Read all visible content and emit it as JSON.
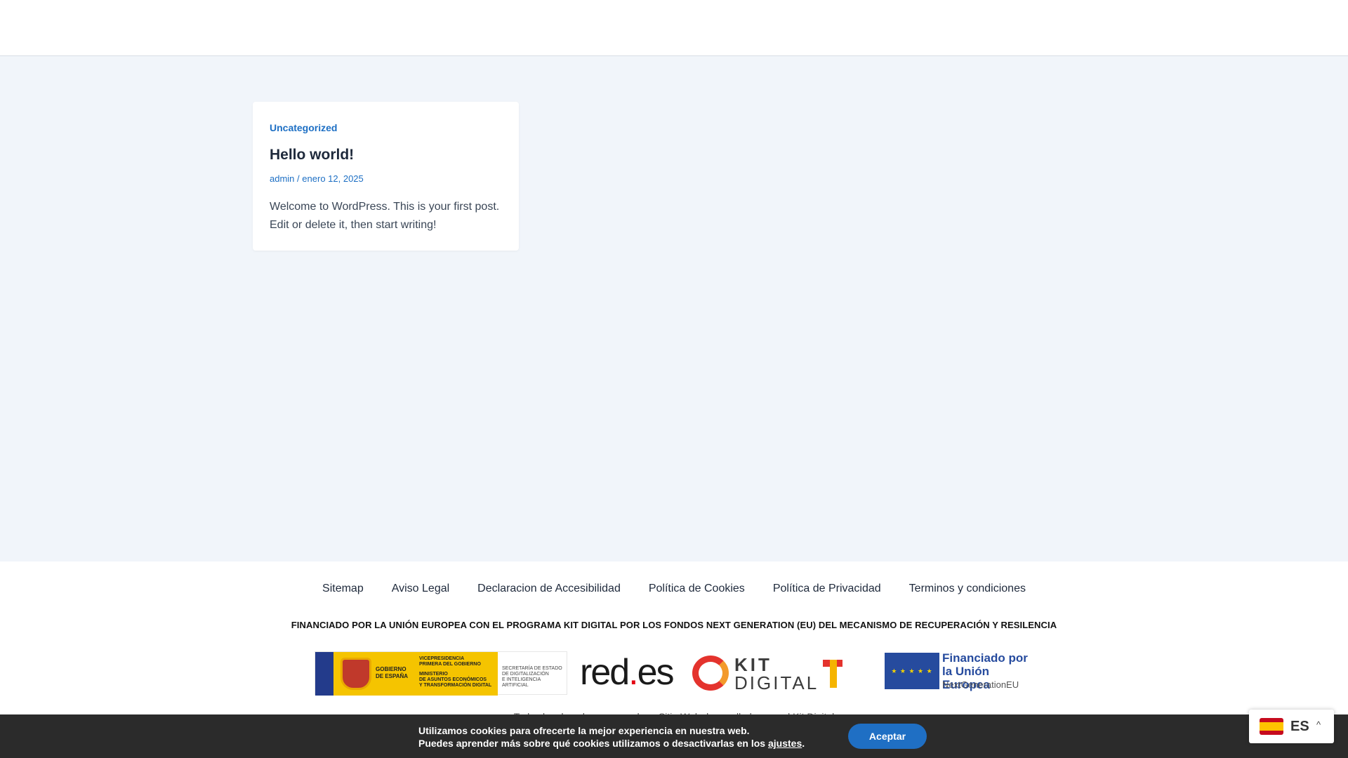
{
  "post": {
    "category": "Uncategorized",
    "title": "Hello world!",
    "author": "admin",
    "separator": "/",
    "date": "enero 12, 2025",
    "excerpt": "Welcome to WordPress. This is your first post. Edit or delete it, then start writing!"
  },
  "footer": {
    "links": [
      "Sitemap",
      "Aviso Legal",
      "Declaracion de Accesibilidad",
      "Política de Cookies",
      "Política de Privacidad",
      "Terminos y condiciones"
    ],
    "funding_text": "FINANCIADO POR LA UNIÓN EUROPEA CON EL PROGRAMA KIT DIGITAL POR LOS FONDOS NEXT GENERATION (EU) DEL MECANISMO DE RECUPERACIÓN Y RESILENCIA",
    "logos": {
      "gobierno_line1": "GOBIERNO",
      "gobierno_line2": "DE ESPAÑA",
      "vice_line1": "VICEPRESIDENCIA",
      "vice_line2": "PRIMERA DEL GOBIERNO",
      "ministerio_line1": "MINISTERIO",
      "ministerio_line2": "DE ASUNTOS ECONÓMICOS",
      "ministerio_line3": "Y TRANSFORMACIÓN DIGITAL",
      "secretaria_line1": "SECRETARÍA DE ESTADO",
      "secretaria_line2": "DE DIGITALIZACIÓN",
      "secretaria_line3": "E INTELIGENCIA ARTIFICIAL",
      "redes_main": "red",
      "redes_dot": ".",
      "redes_tld": "es",
      "kit_line1": "KIT",
      "kit_line2": "DIGITAL",
      "eu_line1": "Financiado por",
      "eu_line2": "la Unión Europea",
      "eu_line3": "NextGenerationEU"
    },
    "credit": "Todos los derechos reservados · Sitio Web desarrollado para el Kit Digital"
  },
  "cookie_banner": {
    "line1": "Utilizamos cookies para ofrecerte la mejor experiencia en nuestra web.",
    "line2_prefix": "Puedes aprender más sobre qué cookies utilizamos o desactivarlas en los ",
    "settings_link": "ajustes",
    "line2_suffix": ".",
    "accept_label": "Aceptar"
  },
  "language_switcher": {
    "code": "ES",
    "caret": "^"
  },
  "colors": {
    "accent": "#1d6fc4",
    "page_background": "#f1f5fa",
    "cookie_background": "#2b2b2b",
    "button": "#1f6fc4"
  }
}
